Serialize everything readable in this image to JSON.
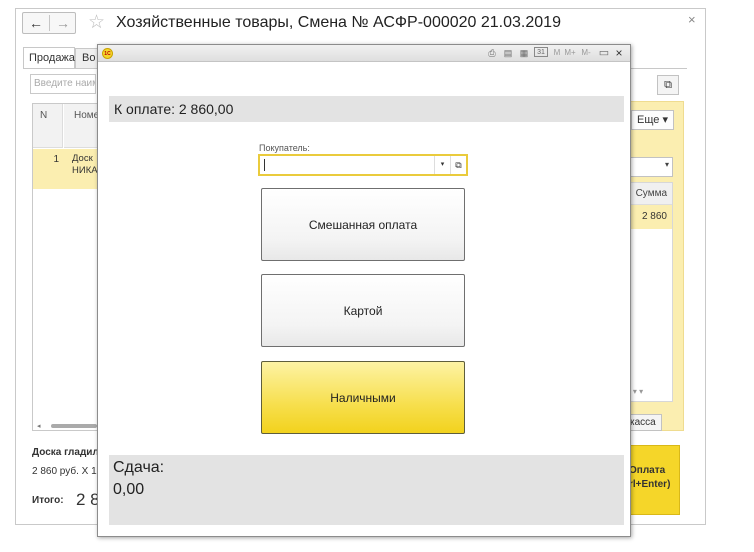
{
  "window": {
    "title": "Хозяйственные товары, Смена № АСФР-000020  21.03.2019",
    "back_icon": "←",
    "forward_icon": "→",
    "star_icon": "☆",
    "close_icon": "×"
  },
  "tabs": [
    {
      "label": "Продажа"
    },
    {
      "label": "Во"
    }
  ],
  "search": {
    "placeholder": "Введите наим"
  },
  "table": {
    "col_n": "N",
    "col_name": "Номе",
    "rows": [
      {
        "n": "1",
        "name_line1": "Доск",
        "name_line2": "НИКА"
      }
    ]
  },
  "bottom": {
    "product": "Доска гладил",
    "price_line": "2 860 руб. X 1",
    "total_label": "Итого:",
    "total_value": "2 8"
  },
  "right_panel": {
    "more_label": "Еще ▾",
    "copy_icon": "⧉",
    "sum_header": "Сумма",
    "sum_value": "2 860",
    "scroll_arrows": "‹ ▾ ▾",
    "kassa_label": "касса",
    "pay_label_line1": "Оплата",
    "pay_label_line2": "rl+Enter)"
  },
  "dialog": {
    "logo": "1С",
    "toolbar": {
      "icon1": "⎙",
      "icon2": "▤",
      "icon3": "▦",
      "icon4": "31",
      "m": "M",
      "m_plus": "M+",
      "m_minus": "M-",
      "restore": "▭",
      "close": "×"
    },
    "due_label": "К оплате: 2 860,00",
    "buyer_label": "Покупатель:",
    "buyer_value": "",
    "dropdown_icon": "▾",
    "open_icon": "⧉",
    "buttons": {
      "mixed": "Смешанная оплата",
      "card": "Картой",
      "cash": "Наличными"
    },
    "change_label": "Сдача:",
    "change_value": "0,00"
  },
  "colors": {
    "accent_yellow": "#f5d629",
    "selection": "#fbeeb0",
    "panel_gray": "#e3e3e3"
  }
}
